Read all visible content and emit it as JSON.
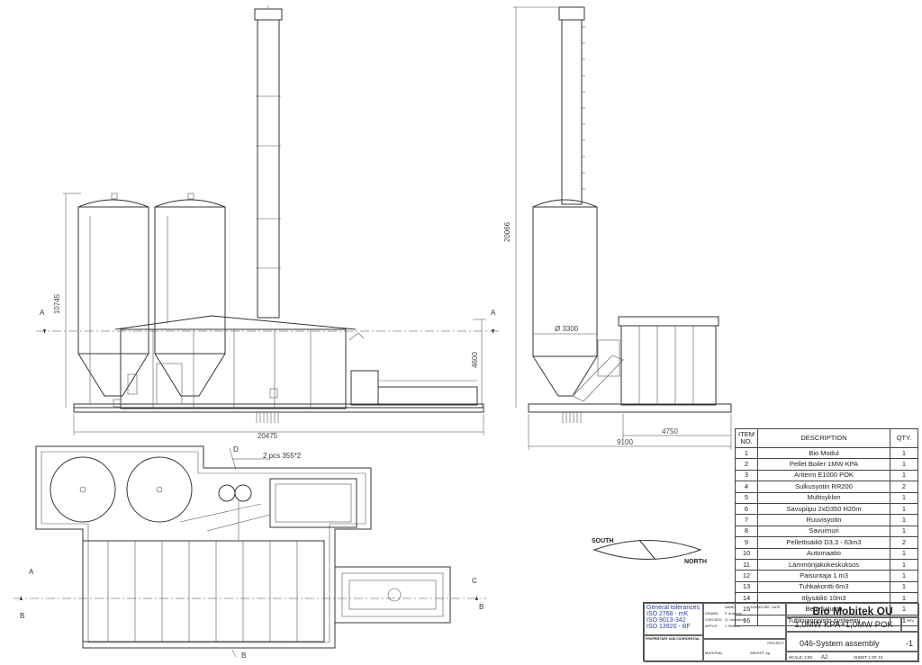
{
  "dimensions": {
    "total_length": "20475",
    "silo_height": "10745",
    "building_height": "4600",
    "chimney_height": "20066",
    "silo_diameter": "Ø 3300",
    "side_width": "9100",
    "container_width": "4750"
  },
  "section_marks": {
    "a": "A",
    "b": "B",
    "c": "C",
    "d": "D"
  },
  "callout": "2 pcs 355*2",
  "compass": {
    "south": "SOUTH",
    "north": "NORTH"
  },
  "bom": {
    "headers": [
      "ITEM NO.",
      "DESCRIPTION",
      "QTY."
    ],
    "rows": [
      [
        "1",
        "Bio Modul",
        "1"
      ],
      [
        "2",
        "Pellet Boiler 1MW KPA",
        "1"
      ],
      [
        "3",
        "Ariterm E1000 POK",
        "1"
      ],
      [
        "4",
        "Sulkusyotin RR200",
        "2"
      ],
      [
        "5",
        "Multisyklon",
        "1"
      ],
      [
        "6",
        "Savupiipu 2xD350 H20m",
        "1"
      ],
      [
        "7",
        "Ruuvisyotin",
        "1"
      ],
      [
        "8",
        "Savuimuri",
        "1"
      ],
      [
        "9",
        "Pellettisäiliö D3,3 - 63m3",
        "2"
      ],
      [
        "10",
        "Automaatio",
        "1"
      ],
      [
        "11",
        "Lämmönjakokeskuksos",
        "1"
      ],
      [
        "12",
        "Paisuntaja 1 m3",
        "1"
      ],
      [
        "13",
        "Tuhkakontti 6m3",
        "1"
      ],
      [
        "14",
        "öljysäiliö 10m3",
        "1"
      ],
      [
        "15",
        "Betonialusta",
        "1"
      ],
      [
        "16",
        "Tuhknanpoisto systeemi",
        "1"
      ]
    ]
  },
  "title_block": {
    "tolerances": [
      "General tolerances",
      "ISO 2768 - mK",
      "ISO 9013-342",
      "ISO 13920 - BF"
    ],
    "company": "Bio Mobitek OU",
    "title": "1,0MW KPA+1,0MW POK",
    "drawing_number": "046-System assembly",
    "revision": "-1",
    "name_label": "NAME",
    "signature_label": "SIGNATURE",
    "date_label": "DATE",
    "drawn_label": "DRAWN",
    "checked_label": "CHECKED",
    "approved_label": "APPV'D",
    "drawn_by": "P. Anselmo",
    "checked_by": "G. Gulmalova",
    "approved_by": "J. Kirsimo",
    "proprietary": "PROPRIETARY AND CONFIDENTIAL",
    "material_label": "MATERIAL",
    "weight_label": "WEIGHT, kg",
    "project_label": "PROJECT",
    "scale_label": "SCALE: 1:80",
    "size": "A2",
    "sheet": "SHEET 1 OF 10",
    "rev_label": "REV"
  }
}
